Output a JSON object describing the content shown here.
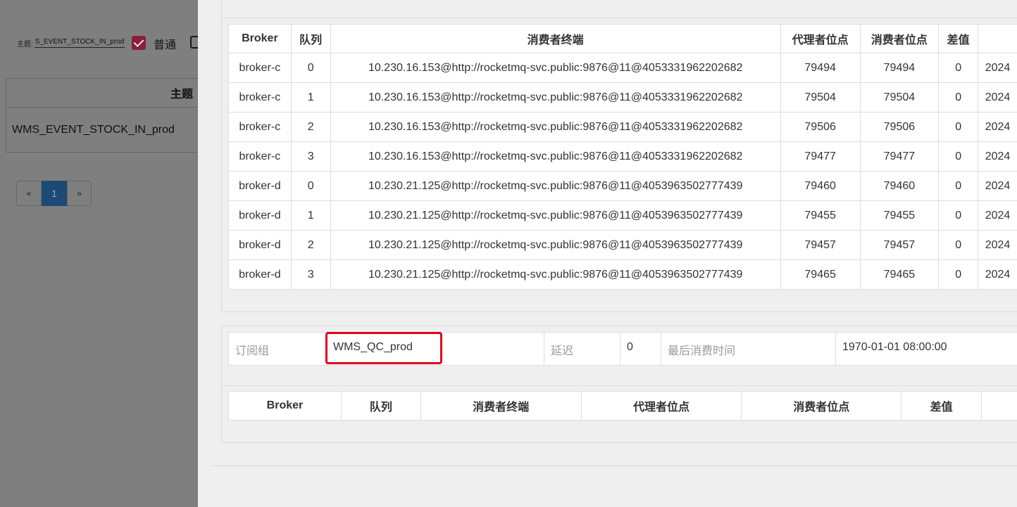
{
  "background": {
    "topic_filter_label": "主题:",
    "topic_filter_value": "S_EVENT_STOCK_IN_prod",
    "checkbox_normal_label": "普通",
    "table_header": "主题",
    "table_row": "WMS_EVENT_STOCK_IN_prod",
    "pager": {
      "prev": "«",
      "current": "1",
      "next": "»"
    }
  },
  "queue_table": {
    "headers": [
      "Broker",
      "队列",
      "消费者终端",
      "代理者位点",
      "消费者位点",
      "差值",
      ""
    ],
    "rows": [
      [
        "broker-c",
        "0",
        "10.230.16.153@http://rocketmq-svc.public:9876@11@4053331962202682",
        "79494",
        "79494",
        "0",
        "2024"
      ],
      [
        "broker-c",
        "1",
        "10.230.16.153@http://rocketmq-svc.public:9876@11@4053331962202682",
        "79504",
        "79504",
        "0",
        "2024"
      ],
      [
        "broker-c",
        "2",
        "10.230.16.153@http://rocketmq-svc.public:9876@11@4053331962202682",
        "79506",
        "79506",
        "0",
        "2024"
      ],
      [
        "broker-c",
        "3",
        "10.230.16.153@http://rocketmq-svc.public:9876@11@4053331962202682",
        "79477",
        "79477",
        "0",
        "2024"
      ],
      [
        "broker-d",
        "0",
        "10.230.21.125@http://rocketmq-svc.public:9876@11@4053963502777439",
        "79460",
        "79460",
        "0",
        "2024"
      ],
      [
        "broker-d",
        "1",
        "10.230.21.125@http://rocketmq-svc.public:9876@11@4053963502777439",
        "79455",
        "79455",
        "0",
        "2024"
      ],
      [
        "broker-d",
        "2",
        "10.230.21.125@http://rocketmq-svc.public:9876@11@4053963502777439",
        "79457",
        "79457",
        "0",
        "2024"
      ],
      [
        "broker-d",
        "3",
        "10.230.21.125@http://rocketmq-svc.public:9876@11@4053963502777439",
        "79465",
        "79465",
        "0",
        "2024"
      ]
    ]
  },
  "group_info": {
    "group_label": "订阅组",
    "group_value": "WMS_QC_prod",
    "delay_label": "延迟",
    "delay_value": "0",
    "last_consume_label": "最后消费时间",
    "last_consume_value": "1970-01-01 08:00:00"
  },
  "queue_table2": {
    "headers": [
      "Broker",
      "队列",
      "消费者终端",
      "代理者位点",
      "消费者位点",
      "差值",
      ""
    ]
  },
  "colors": {
    "highlight": "#e0001b",
    "overlay": "#7f7f7f",
    "pager_active": "#1d4a74"
  }
}
